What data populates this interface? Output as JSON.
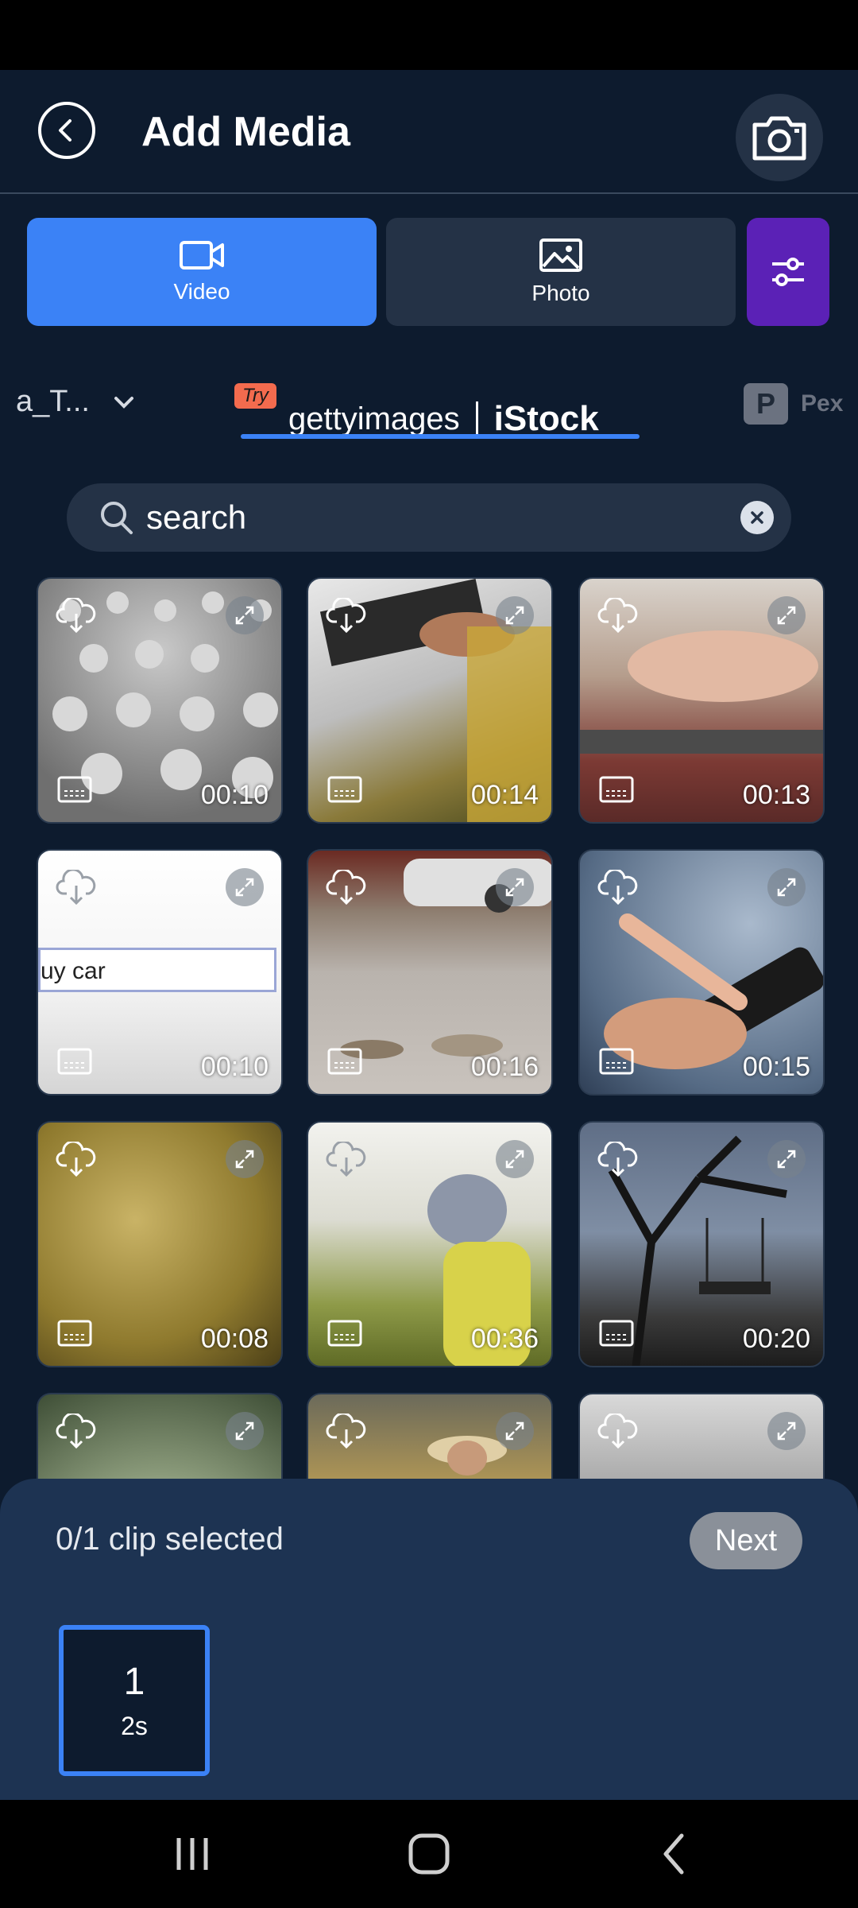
{
  "header": {
    "title": "Add Media"
  },
  "media_type_tabs": [
    {
      "label": "Video",
      "selected": true
    },
    {
      "label": "Photo",
      "selected": false
    }
  ],
  "sources": {
    "folder_label": "a_T...",
    "getty": {
      "try_badge": "Try",
      "brand_getty": "gettyimages",
      "brand_istock": "iStock"
    },
    "pexels": {
      "icon_letter": "P",
      "label": "Pex"
    }
  },
  "search": {
    "value": "search"
  },
  "thumbnails": [
    {
      "duration": "00:10",
      "image": "gray figures crowd"
    },
    {
      "duration": "00:14",
      "image": "hands typing on laptop"
    },
    {
      "duration": "00:13",
      "image": "hand typing closeup"
    },
    {
      "duration": "00:10",
      "image": "search box buy car",
      "overlay_text": "uy car"
    },
    {
      "duration": "00:16",
      "image": "coins on road with car"
    },
    {
      "duration": "00:15",
      "image": "hand holding smartphone"
    },
    {
      "duration": "00:08",
      "image": "old map"
    },
    {
      "duration": "00:36",
      "image": "child in hat outdoors"
    },
    {
      "duration": "00:20",
      "image": "tree silhouette swing"
    },
    {
      "duration": "",
      "image": "pool lights"
    },
    {
      "duration": "",
      "image": "person in hat playground"
    },
    {
      "duration": "",
      "image": "building street"
    }
  ],
  "selection_panel": {
    "count_text": "0/1 clip selected",
    "next_label": "Next",
    "slot_number": "1",
    "slot_duration": "2s"
  },
  "colors": {
    "background": "#0d1b2e",
    "accent_blue": "#3b82f6",
    "filter_purple": "#5b21b6",
    "panel": "#1d3352"
  }
}
